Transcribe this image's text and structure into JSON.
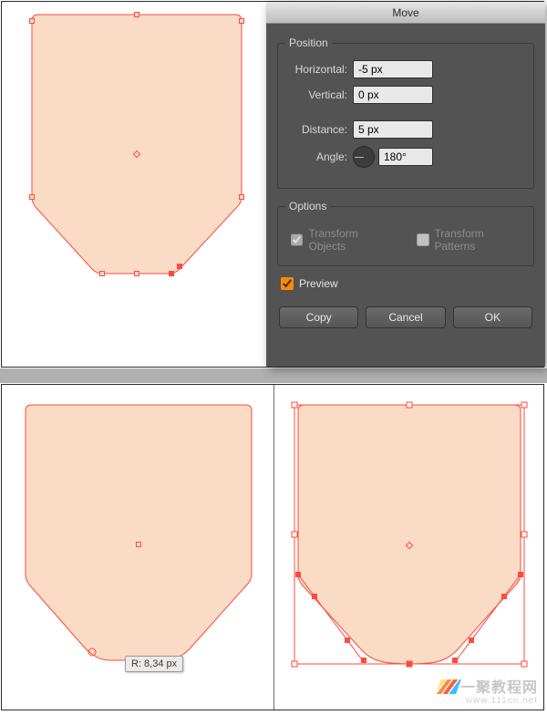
{
  "dialog": {
    "title": "Move",
    "position": {
      "legend": "Position",
      "horizontal_label": "Horizontal:",
      "horizontal_value": "-5 px",
      "vertical_label": "Vertical:",
      "vertical_value": "0 px",
      "distance_label": "Distance:",
      "distance_value": "5 px",
      "angle_label": "Angle:",
      "angle_value": "180°"
    },
    "options": {
      "legend": "Options",
      "transform_objects_label": "Transform Objects",
      "transform_objects_checked": true,
      "transform_patterns_label": "Transform Patterns",
      "transform_patterns_checked": false
    },
    "preview": {
      "label": "Preview",
      "checked": true
    },
    "buttons": {
      "copy": "Copy",
      "cancel": "Cancel",
      "ok": "OK"
    }
  },
  "tooltip_radius": "R: 8,34 px",
  "watermark": {
    "brand": "一聚教程网",
    "url": "www.111cn.net"
  },
  "colors": {
    "fill": "#fadbc6",
    "stroke": "#fa4b3e"
  }
}
